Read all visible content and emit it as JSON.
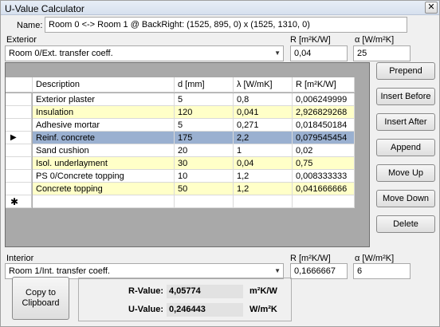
{
  "window": {
    "title": "U-Value Calculator",
    "close_glyph": "✕"
  },
  "name_label": "Name:",
  "name_value": "Room 0 <-> Room 1 @ BackRight: (1525, 895, 0) x (1525, 1310, 0)",
  "exterior": {
    "label": "Exterior",
    "combo_value": "Room 0/Ext. transfer coeff.",
    "r_label": "R [m²K/W]",
    "r_value": "0,04",
    "alpha_label": "α [W/m²K]",
    "alpha_value": "25"
  },
  "grid": {
    "columns": [
      "Description",
      "d [mm]",
      "λ [W/mK]",
      "R [m²K/W]"
    ],
    "rows": [
      {
        "description": "Exterior plaster",
        "d": "5",
        "lambda": "0,8",
        "r": "0,006249999",
        "style": "white",
        "marker": ""
      },
      {
        "description": "Insulation",
        "d": "120",
        "lambda": "0,041",
        "r": "2,926829268",
        "style": "yellow",
        "marker": ""
      },
      {
        "description": "Adhesive mortar",
        "d": "5",
        "lambda": "0,271",
        "r": "0,018450184",
        "style": "white",
        "marker": ""
      },
      {
        "description": "Reinf. concrete",
        "d": "175",
        "lambda": "2,2",
        "r": "0,079545454",
        "style": "selected",
        "marker": "▶"
      },
      {
        "description": "Sand cushion",
        "d": "20",
        "lambda": "1",
        "r": "0,02",
        "style": "white",
        "marker": ""
      },
      {
        "description": "Isol. underlayment",
        "d": "30",
        "lambda": "0,04",
        "r": "0,75",
        "style": "yellow",
        "marker": ""
      },
      {
        "description": "PS 0/Concrete topping",
        "d": "10",
        "lambda": "1,2",
        "r": "0,008333333",
        "style": "white",
        "marker": ""
      },
      {
        "description": "Concrete topping",
        "d": "50",
        "lambda": "1,2",
        "r": "0,041666666",
        "style": "yellow",
        "marker": ""
      }
    ],
    "new_row_marker": "✱"
  },
  "buttons": {
    "prepend": "Prepend",
    "insert_before": "Insert Before",
    "insert_after": "Insert After",
    "append": "Append",
    "move_up": "Move Up",
    "move_down": "Move Down",
    "delete": "Delete",
    "copy_line1": "Copy to",
    "copy_line2": "Clipboard"
  },
  "interior": {
    "label": "Interior",
    "combo_value": "Room 1/Int. transfer coeff.",
    "r_label": "R [m²K/W]",
    "r_value": "0,1666667",
    "alpha_label": "α [W/m²K]",
    "alpha_value": "6"
  },
  "results": {
    "r_label": "R-Value:",
    "r_value": "4,05774",
    "r_unit": "m²K/W",
    "u_label": "U-Value:",
    "u_value": "0,246443",
    "u_unit": "W/m²K"
  },
  "colors": {
    "row_white": "#ffffff",
    "row_yellow": "#ffffc8",
    "row_selected": "#9ab0d0",
    "grid_bg": "#a9a9a9"
  }
}
